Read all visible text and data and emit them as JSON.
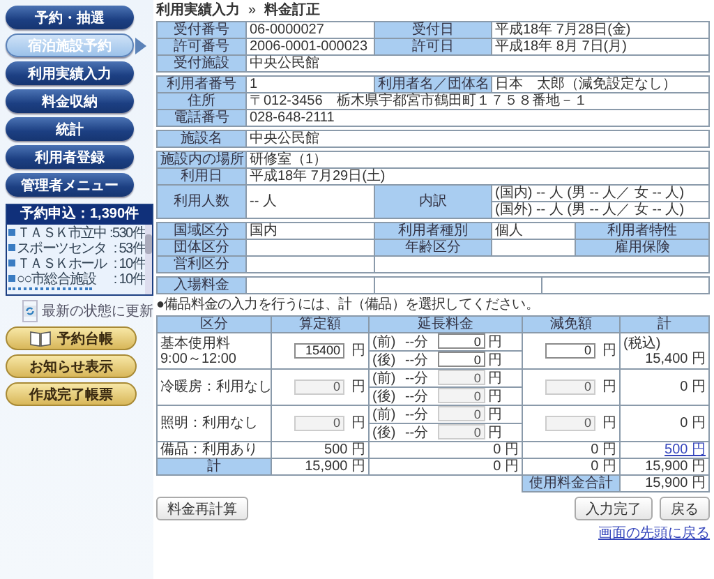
{
  "nav": [
    {
      "label": "予約・抽選",
      "selected": false
    },
    {
      "label": "宿泊施設予約",
      "selected": true
    },
    {
      "label": "利用実績入力",
      "selected": false
    },
    {
      "label": "料金収納",
      "selected": false
    },
    {
      "label": "統計",
      "selected": false
    },
    {
      "label": "利用者登録",
      "selected": false
    },
    {
      "label": "管理者メニュー",
      "selected": false
    }
  ],
  "requests": {
    "title": "予約申込：1,390件",
    "items": [
      {
        "name": "ＴＡＳＫ市立中",
        "count": ":530件"
      },
      {
        "name": "スポーツセンタ",
        "count": ": 53件"
      },
      {
        "name": "ＴＡＳＫホール",
        "count": ": 10件"
      },
      {
        "name": "○○市総合施設",
        "count": ": 10件"
      }
    ]
  },
  "refresh": {
    "label": "最新の状態に更新"
  },
  "side_buttons": [
    {
      "label": "予約台帳",
      "kind": "book"
    },
    {
      "label": "お知らせ表示",
      "kind": "plain"
    },
    {
      "label": "作成完了帳票",
      "kind": "plain"
    }
  ],
  "breadcrumb": {
    "parent": "利用実績入力",
    "separator": "»",
    "current": "料金訂正"
  },
  "info_tables": [
    {
      "rows": [
        [
          {
            "kind": "head",
            "text": "受付番号"
          },
          {
            "kind": "value",
            "text": "06-0000027"
          },
          {
            "kind": "head",
            "text": "受付日"
          },
          {
            "kind": "value",
            "text": "平成18年 7月28日(金)"
          }
        ],
        [
          {
            "kind": "head",
            "text": "許可番号"
          },
          {
            "kind": "value",
            "text": "2006-0001-000023"
          },
          {
            "kind": "head",
            "text": "許可日"
          },
          {
            "kind": "value",
            "text": "平成18年 8月 7日(月)"
          }
        ],
        [
          {
            "kind": "head",
            "text": "受付施設"
          },
          {
            "kind": "value",
            "text": "中央公民館",
            "colspan": 3
          }
        ]
      ]
    },
    {
      "rows": [
        [
          {
            "kind": "head",
            "text": "利用者番号"
          },
          {
            "kind": "value",
            "text": "1"
          },
          {
            "kind": "head",
            "text": "利用者名／団体名"
          },
          {
            "kind": "value",
            "text": "日本　太郎（減免設定なし）"
          }
        ],
        [
          {
            "kind": "head",
            "text": "住所"
          },
          {
            "kind": "value",
            "text": "〒012-3456　栃木県宇都宮市鶴田町１７５８番地－１",
            "colspan": 3
          }
        ],
        [
          {
            "kind": "head",
            "text": "電話番号"
          },
          {
            "kind": "value",
            "text": "028-648-2111",
            "colspan": 3
          }
        ]
      ]
    },
    {
      "rows": [
        [
          {
            "kind": "head",
            "text": "施設名"
          },
          {
            "kind": "value",
            "text": "中央公民館",
            "colspan": 3
          }
        ]
      ]
    },
    {
      "rows": [
        [
          {
            "kind": "head",
            "text": "施設内の場所"
          },
          {
            "kind": "value",
            "text": "研修室（1）",
            "colspan": 3
          }
        ],
        [
          {
            "kind": "head",
            "text": "利用日"
          },
          {
            "kind": "value",
            "text": "平成18年 7月29日(土)",
            "colspan": 3
          }
        ],
        [
          {
            "kind": "head",
            "text": "利用人数",
            "rowspan": 2
          },
          {
            "kind": "value",
            "text": "-- 人",
            "rowspan": 2
          },
          {
            "kind": "head",
            "text": "内訳",
            "rowspan": 2
          },
          {
            "kind": "value",
            "text": "(国内) -- 人 (男 -- 人／ 女 -- 人)"
          }
        ],
        [
          {
            "kind": "value",
            "text": "(国外) -- 人 (男 -- 人／ 女 -- 人)"
          }
        ]
      ]
    },
    {
      "rows": [
        [
          {
            "kind": "head",
            "text": "国域区分"
          },
          {
            "kind": "value",
            "text": "国内"
          },
          {
            "kind": "head",
            "text": "利用者種別"
          },
          {
            "kind": "value",
            "text": "個人"
          },
          {
            "kind": "head",
            "text": "利用者特性"
          }
        ],
        [
          {
            "kind": "head",
            "text": "団体区分"
          },
          {
            "kind": "value"
          },
          {
            "kind": "head",
            "text": "年齢区分"
          },
          {
            "kind": "value"
          },
          {
            "kind": "head",
            "text": "雇用保険"
          }
        ],
        [
          {
            "kind": "head",
            "text": "営利区分"
          },
          {
            "kind": "value"
          },
          {
            "kind": "value",
            "colspan": 3
          }
        ]
      ]
    },
    {
      "rows": [
        [
          {
            "kind": "head",
            "text": "入場料金"
          },
          {
            "kind": "value"
          },
          {
            "kind": "value"
          },
          {
            "kind": "value"
          }
        ]
      ]
    }
  ],
  "note": "●備品料金の入力を行うには、計（備品）を選択してください。",
  "fees": {
    "columns": [
      "区分",
      "算定額",
      "延長料金",
      "減免額",
      "計"
    ],
    "rows": [
      {
        "kind": "input",
        "label": "基本使用料",
        "sublabel": "9:00～12:00",
        "calc": {
          "value": "15400",
          "unit": "円",
          "disabled": false
        },
        "ext": [
          {
            "prefix": "(前)",
            "minutes": "--分",
            "value": "0",
            "unit": "円",
            "disabled": false
          },
          {
            "prefix": "(後)",
            "minutes": "--分",
            "value": "0",
            "unit": "円",
            "disabled": false
          }
        ],
        "reduction": {
          "value": "0",
          "unit": "円",
          "disabled": false
        },
        "total_note": "(税込)",
        "total": "15,400 円"
      },
      {
        "kind": "input",
        "label": "冷暖房：利用なし",
        "calc": {
          "value": "0",
          "unit": "円",
          "disabled": true
        },
        "ext": [
          {
            "prefix": "(前)",
            "minutes": "--分",
            "value": "0",
            "unit": "円",
            "disabled": true
          },
          {
            "prefix": "(後)",
            "minutes": "--分",
            "value": "0",
            "unit": "円",
            "disabled": true
          }
        ],
        "reduction": {
          "value": "0",
          "unit": "円",
          "disabled": true
        },
        "total": "0 円"
      },
      {
        "kind": "input",
        "label": "照明：利用なし",
        "calc": {
          "value": "0",
          "unit": "円",
          "disabled": true
        },
        "ext": [
          {
            "prefix": "(前)",
            "minutes": "--分",
            "value": "0",
            "unit": "円",
            "disabled": true
          },
          {
            "prefix": "(後)",
            "minutes": "--分",
            "value": "0",
            "unit": "円",
            "disabled": true
          }
        ],
        "reduction": {
          "value": "0",
          "unit": "円",
          "disabled": true
        },
        "total": "0 円"
      },
      {
        "kind": "plain",
        "label": "備品：利用あり",
        "calc": "500 円",
        "ext": "0 円",
        "reduction": "0 円",
        "total": "500 円",
        "link": true
      },
      {
        "kind": "sum",
        "label": "計",
        "calc": "15,900 円",
        "ext": "0 円",
        "reduction": "0 円",
        "total": "15,900 円",
        "link": false
      }
    ],
    "grand_total": {
      "label": "使用料金合計",
      "value": "15,900 円"
    }
  },
  "recalc_button": "料金再計算",
  "buttons": [
    "入力完了",
    "戻る"
  ],
  "top_link": "画面の先頭に戻る"
}
